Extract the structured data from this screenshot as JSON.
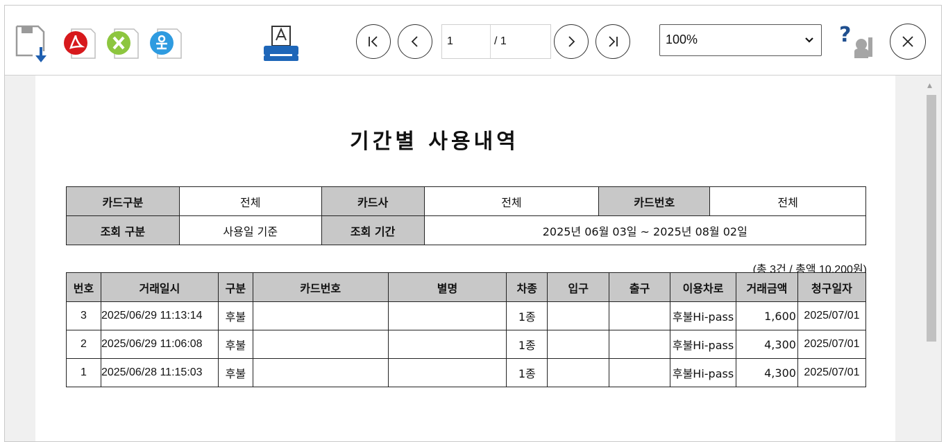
{
  "toolbar": {
    "icons": [
      "save-icon",
      "pdf-icon",
      "excel-icon",
      "hwp-icon",
      "print-icon",
      "help-icon",
      "close-icon"
    ],
    "nav": {
      "first": "first-page",
      "prev": "prev-page",
      "next": "next-page",
      "last": "last-page"
    },
    "page_current": "1",
    "page_total": "/ 1",
    "zoom": "100%"
  },
  "report": {
    "title": "기간별 사용내역",
    "conditions": {
      "card_type_label": "카드구분",
      "card_type_value": "전체",
      "card_company_label": "카드사",
      "card_company_value": "전체",
      "card_number_label": "카드번호",
      "card_number_value": "전체",
      "query_type_label": "조회 구분",
      "query_type_value": "사용일 기준",
      "query_period_label": "조회 기간",
      "query_period_value": "2025년 06월 03일 ~ 2025년 08월 02일"
    },
    "summary": "(총 3건 / 총액 10,200원)",
    "columns": [
      "번호",
      "거래일시",
      "구분",
      "카드번호",
      "별명",
      "차종",
      "입구",
      "출구",
      "이용차로",
      "거래금액",
      "청구일자"
    ],
    "rows": [
      [
        "3",
        "2025/06/29 11:13:14",
        "후불",
        "",
        "",
        "1종",
        "",
        "",
        "후불Hi-pass",
        "1,600",
        "2025/07/01"
      ],
      [
        "2",
        "2025/06/29 11:06:08",
        "후불",
        "",
        "",
        "1종",
        "",
        "",
        "후불Hi-pass",
        "4,300",
        "2025/07/01"
      ],
      [
        "1",
        "2025/06/28 11:15:03",
        "후불",
        "",
        "",
        "1종",
        "",
        "",
        "후불Hi-pass",
        "4,300",
        "2025/07/01"
      ]
    ]
  },
  "colors": {
    "pdf": "#d7191c",
    "excel": "#8dc63f",
    "hwp": "#2e9be0",
    "printer": "#1e66b8",
    "header_bg": "#c8c8c8"
  }
}
